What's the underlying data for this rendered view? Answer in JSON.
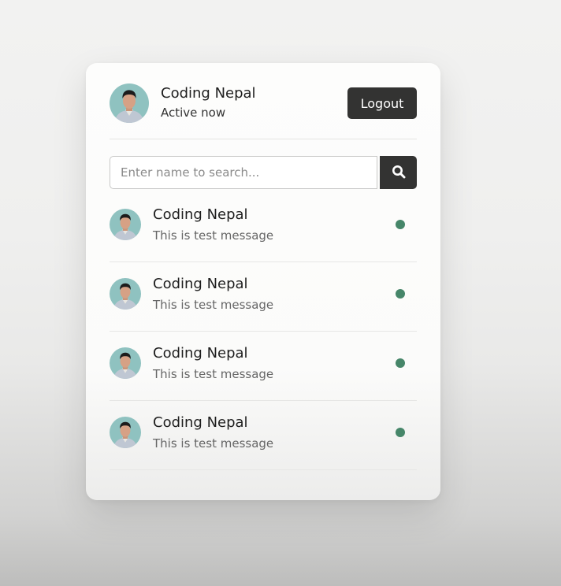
{
  "header": {
    "name": "Coding Nepal",
    "status": "Active now",
    "logout_label": "Logout"
  },
  "search": {
    "placeholder": "Enter name to search...",
    "icon": "search-icon"
  },
  "users": [
    {
      "name": "Coding Nepal",
      "message": "This is test message",
      "online": true
    },
    {
      "name": "Coding Nepal",
      "message": "This is test message",
      "online": true
    },
    {
      "name": "Coding Nepal",
      "message": "This is test message",
      "online": true
    },
    {
      "name": "Coding Nepal",
      "message": "This is test message",
      "online": true
    }
  ],
  "colors": {
    "button_bg": "#333332",
    "online_dot": "#468669",
    "avatar_bg": "#8fc2c0"
  }
}
